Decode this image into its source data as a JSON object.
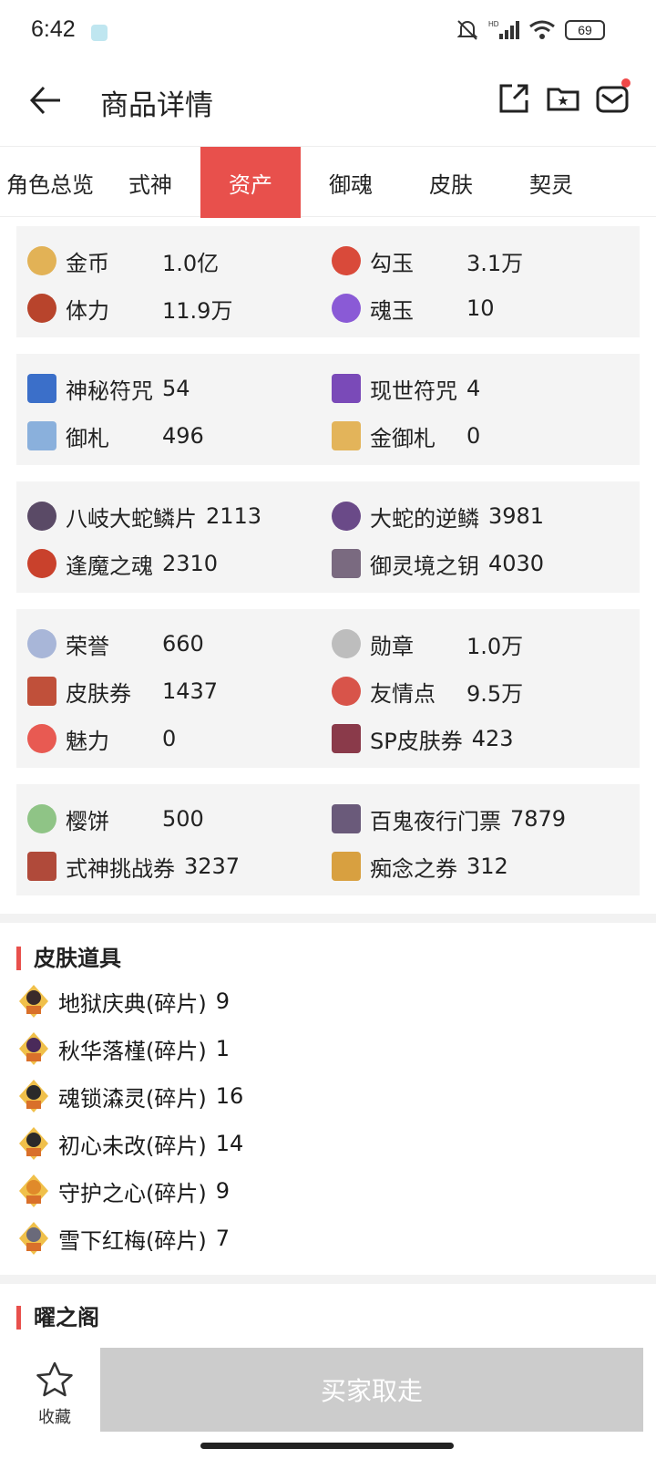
{
  "status": {
    "time": "6:42",
    "battery": "69"
  },
  "header": {
    "title": "商品详情"
  },
  "tabs": [
    {
      "label": "角色总览"
    },
    {
      "label": "式神"
    },
    {
      "label": "资产"
    },
    {
      "label": "御魂"
    },
    {
      "label": "皮肤"
    },
    {
      "label": "契灵"
    }
  ],
  "assets": {
    "card1": [
      {
        "label": "金币",
        "value": "1.0亿",
        "icon": "gold-coin-icon",
        "color": "#e2b256"
      },
      {
        "label": "勾玉",
        "value": "3.1万",
        "icon": "magatama-icon",
        "color": "#d94a3a"
      },
      {
        "label": "体力",
        "value": "11.9万",
        "icon": "stamina-icon",
        "color": "#b8442c"
      },
      {
        "label": "魂玉",
        "value": "10",
        "icon": "soul-jade-icon",
        "color": "#8a5ad6"
      }
    ],
    "card2": [
      {
        "label": "神秘符咒",
        "value": "54",
        "icon": "mystery-charm-icon",
        "color": "#3b6fc9"
      },
      {
        "label": "现世符咒",
        "value": "4",
        "icon": "present-charm-icon",
        "color": "#7a4ab8"
      },
      {
        "label": "御札",
        "value": "496",
        "icon": "talisman-icon",
        "color": "#8ab0dc"
      },
      {
        "label": "金御札",
        "value": "0",
        "icon": "gold-talisman-icon",
        "color": "#e3b45a"
      }
    ],
    "card3": [
      {
        "label": "八岐大蛇鳞片",
        "value": "2113",
        "icon": "orochi-scale-icon",
        "color": "#5a4a66"
      },
      {
        "label": "大蛇的逆鳞",
        "value": "3981",
        "icon": "reverse-scale-icon",
        "color": "#6a4a88"
      },
      {
        "label": "逢魔之魂",
        "value": "2310",
        "icon": "demon-soul-icon",
        "color": "#c9412c"
      },
      {
        "label": "御灵境之钥",
        "value": "4030",
        "icon": "spirit-key-icon",
        "color": "#7a6a80"
      }
    ],
    "card4": [
      {
        "label": "荣誉",
        "value": "660",
        "icon": "honor-icon",
        "color": "#a8b6d8"
      },
      {
        "label": "勋章",
        "value": "1.0万",
        "icon": "medal-icon",
        "color": "#bdbdbd"
      },
      {
        "label": "皮肤券",
        "value": "1437",
        "icon": "skin-ticket-icon",
        "color": "#c0503a"
      },
      {
        "label": "友情点",
        "value": "9.5万",
        "icon": "friendship-icon",
        "color": "#d8544a"
      },
      {
        "label": "魅力",
        "value": "0",
        "icon": "charm-heart-icon",
        "color": "#e85a52"
      },
      {
        "label": "SP皮肤券",
        "value": "423",
        "icon": "sp-skin-ticket-icon",
        "color": "#8a3a4a"
      }
    ],
    "card5": [
      {
        "label": "樱饼",
        "value": "500",
        "icon": "sakura-mochi-icon",
        "color": "#8fc486"
      },
      {
        "label": "百鬼夜行门票",
        "value": "7879",
        "icon": "night-parade-ticket-icon",
        "color": "#6a5a7a"
      },
      {
        "label": "式神挑战券",
        "value": "3237",
        "icon": "shikigami-challenge-icon",
        "color": "#b04a3a"
      },
      {
        "label": "痴念之券",
        "value": "312",
        "icon": "obsession-ticket-icon",
        "color": "#d8a040"
      }
    ]
  },
  "skin_items": {
    "title": "皮肤道具",
    "items": [
      {
        "name": "地狱庆典(碎片)",
        "count": "9",
        "color": "#3a2a2a"
      },
      {
        "name": "秋华落槿(碎片)",
        "count": "1",
        "color": "#4a2a5a"
      },
      {
        "name": "魂锁潹灵(碎片)",
        "count": "16",
        "color": "#2a2a2a"
      },
      {
        "name": "初心未改(碎片)",
        "count": "14",
        "color": "#2a2a2a"
      },
      {
        "name": "守护之心(碎片)",
        "count": "9",
        "color": "#e08a2a"
      },
      {
        "name": "雪下红梅(碎片)",
        "count": "7",
        "color": "#6a6a7a"
      }
    ],
    "badge": "碎片"
  },
  "next_section": {
    "title": "曜之阁"
  },
  "bottom": {
    "favorite_label": "收藏",
    "buy_label": "买家取走"
  },
  "colors": {
    "accent": "#e8504c",
    "card_bg": "#f4f4f4",
    "button_disabled": "#cccccc"
  }
}
